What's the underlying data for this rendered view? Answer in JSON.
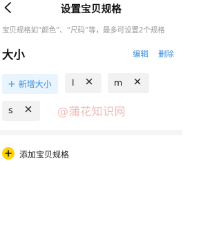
{
  "header": {
    "title": "设置宝贝规格",
    "back_icon": "chevron-left-icon"
  },
  "hint": "宝贝规格如“颜色”、“尺码”等，最多可设置2个规格",
  "spec": {
    "name": "大小",
    "edit_label": "编辑",
    "delete_label": "删除",
    "add_value_label": "新增大小",
    "add_value_icon": "plus-icon",
    "values": [
      {
        "label": "l",
        "remove_icon": "close-icon"
      },
      {
        "label": "m",
        "remove_icon": "close-icon"
      },
      {
        "label": "s",
        "remove_icon": "close-icon"
      }
    ]
  },
  "add_spec": {
    "label": "添加宝贝规格",
    "icon": "plus-circle-icon"
  },
  "watermark": "@蒲花知识网",
  "colors": {
    "accent_blue": "#3a8fe0",
    "add_chip_bg": "#e9f4fd",
    "chip_bg": "#f2f2f2",
    "add_icon_yellow": "#ffd400",
    "hint_gray": "#999999"
  }
}
